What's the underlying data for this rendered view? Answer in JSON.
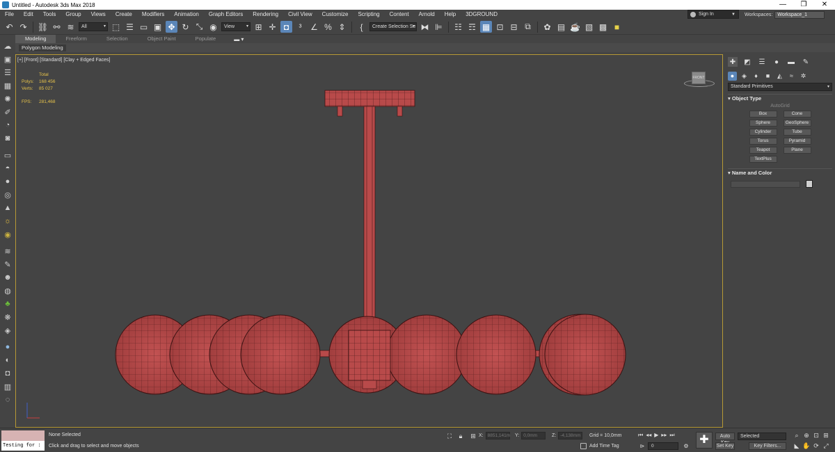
{
  "window": {
    "title": "Untitled - Autodesk 3ds Max 2018",
    "controls": [
      "—",
      "❐",
      "✕"
    ]
  },
  "menu": [
    "File",
    "Edit",
    "Tools",
    "Group",
    "Views",
    "Create",
    "Modifiers",
    "Animation",
    "Graph Editors",
    "Rendering",
    "Civil View",
    "Customize",
    "Scripting",
    "Content",
    "Arnold",
    "Help",
    "3DGROUND"
  ],
  "account": {
    "signin_label": "Sign In"
  },
  "workspaces": {
    "label": "Workspaces:",
    "value": "Workspace_1"
  },
  "toolbar": {
    "filter_value": "All",
    "view_value": "View",
    "selection_set_placeholder": "Create Selection Se"
  },
  "ribbon": {
    "tabs": [
      "Modeling",
      "Freeform",
      "Selection",
      "Object Paint",
      "Populate"
    ],
    "active_tab": "Modeling",
    "panel_label": "Polygon Modeling"
  },
  "viewport": {
    "label": "[+] [Front] [Standard] [Clay + Edged Faces]",
    "stats": {
      "header": "Total",
      "polys_label": "Polys:",
      "polys_value": "168 456",
      "verts_label": "Verts:",
      "verts_value": "85 027",
      "fps_label": "FPS:",
      "fps_value": "281,468"
    },
    "viewcube_label": "FRONT",
    "model_color": "#b84a4a",
    "border_color": "#b79a35"
  },
  "command_panel": {
    "category": "Standard Primitives",
    "object_type_title": "Object Type",
    "autogrid_label": "AutoGrid",
    "primitives": [
      "Box",
      "Cone",
      "Sphere",
      "GeoSphere",
      "Cylinder",
      "Tube",
      "Torus",
      "Pyramid",
      "Teapot",
      "Plane",
      "TextPlus"
    ],
    "name_color_title": "Name and Color"
  },
  "status": {
    "maxscript_value": "Testing for :",
    "selection_text": "None Selected",
    "prompt_text": "Click and drag to select and move objects",
    "x_label": "X:",
    "x_value": "8851,141m",
    "y_label": "Y:",
    "y_value": "0,0mm",
    "z_label": "Z:",
    "z_value": "-4,138mm",
    "grid_text": "Grid = 10,0mm",
    "add_time_tag": "Add Time Tag",
    "frame_value": "0",
    "autokey_label": "Auto Key",
    "setkey_label": "Set Key",
    "selected_value": "Selected",
    "key_filters_label": "Key Filters..."
  }
}
